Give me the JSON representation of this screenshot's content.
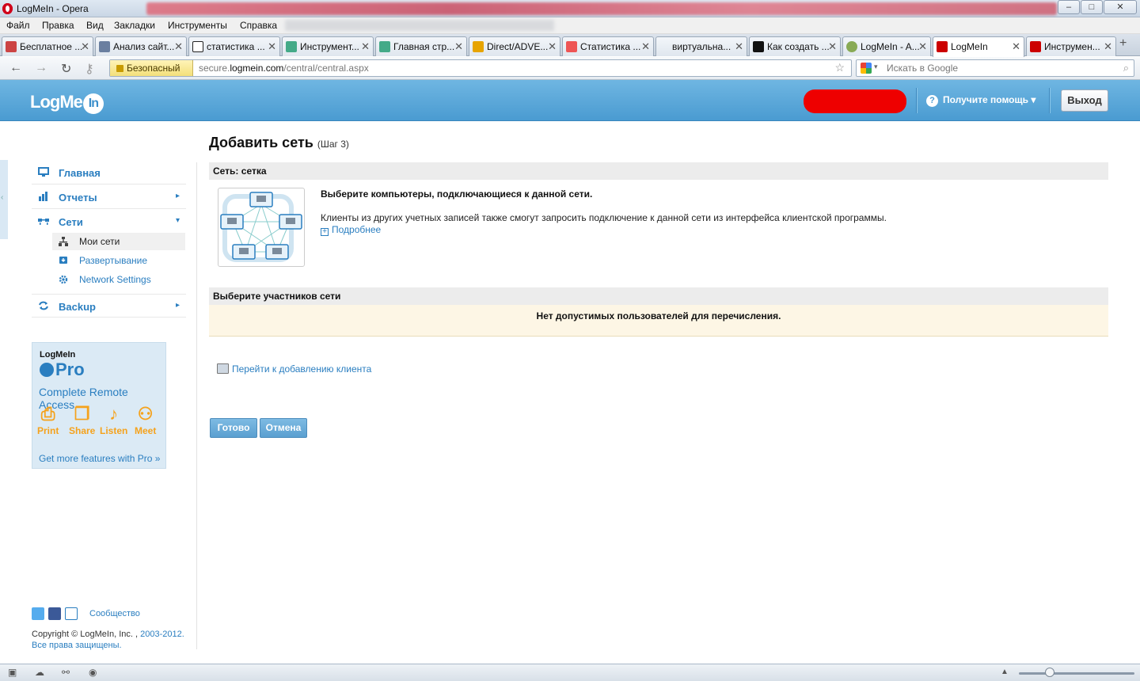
{
  "window": {
    "title": "LogMeIn - Opera",
    "minimize": "–",
    "maximize": "□",
    "close": "✕"
  },
  "menu": [
    "Файл",
    "Правка",
    "Вид",
    "Закладки",
    "Инструменты",
    "Справка"
  ],
  "tabs": [
    {
      "label": "Бесплатное ...",
      "color": "#c44"
    },
    {
      "label": "Анализ сайт...",
      "color": "#6a7fa0"
    },
    {
      "label": "статистика ...",
      "color": "#222"
    },
    {
      "label": "Инструмент...",
      "color": "#4a8"
    },
    {
      "label": "Главная стр...",
      "color": "#4a8"
    },
    {
      "label": "Direct/ADVE...",
      "color": "#e7a400"
    },
    {
      "label": "Статистика ...",
      "color": "#e55"
    },
    {
      "label": "виртуальна...",
      "color": "#fff"
    },
    {
      "label": "Как создать ...",
      "color": "#111"
    },
    {
      "label": "LogMeIn - A...",
      "color": "#8a5"
    },
    {
      "label": "LogMeIn",
      "color": "#c00"
    },
    {
      "label": "Инструмен...",
      "color": "#c00"
    }
  ],
  "newtab_glyph": "+",
  "addressbar": {
    "secure_label": "Безопасный",
    "url_prefix": "secure.",
    "url_domain": "logmein.com",
    "url_path": "/central/central.aspx",
    "search_placeholder": "Искать в Google"
  },
  "header": {
    "logo": "LogMe",
    "logo_in": "In",
    "help": "Получите помощь ▾",
    "logout": "Выход"
  },
  "sidebar": {
    "items": [
      {
        "label": "Главная",
        "arrow": ""
      },
      {
        "label": "Отчеты",
        "arrow": "▸"
      },
      {
        "label": "Сети",
        "arrow": "▾"
      },
      {
        "label": "Backup",
        "arrow": "▸"
      }
    ],
    "subitems": [
      {
        "label": "Мои сети"
      },
      {
        "label": "Развертывание"
      },
      {
        "label": "Network Settings"
      }
    ]
  },
  "promo": {
    "brand": "LogMeIn",
    "product": "Pro",
    "tagline": "Complete Remote Access",
    "features": [
      "Print",
      "Share",
      "Listen",
      "Meet"
    ],
    "more": "Get more features with Pro »"
  },
  "footer": {
    "community": "Сообщество",
    "copyright": "Copyright © LogMeIn, Inc. , ",
    "years": "2003-2012.",
    "rights": "Все права защищены."
  },
  "main": {
    "title": "Добавить сеть",
    "step": "(Шаг 3)",
    "network_header": "Сеть: сетка",
    "choose_computers": "Выберите компьютеры, подключающиеся к данной сети.",
    "clients_note": "Клиенты из других учетных записей также смогут запросить подключение к данной сети из интерфейса клиентской программы.",
    "more_link": "Подробнее",
    "members_header": "Выберите участников сети",
    "no_users": "Нет допустимых пользователей для перечисления.",
    "add_client_link": "Перейти к добавлению клиента",
    "done_button": "Готово",
    "cancel_button": "Отмена"
  },
  "colors": {
    "accent": "#2a7ec0",
    "header": "#4a9bd1",
    "promo_orange": "#f5a21c",
    "redaction": "#ee0000"
  }
}
